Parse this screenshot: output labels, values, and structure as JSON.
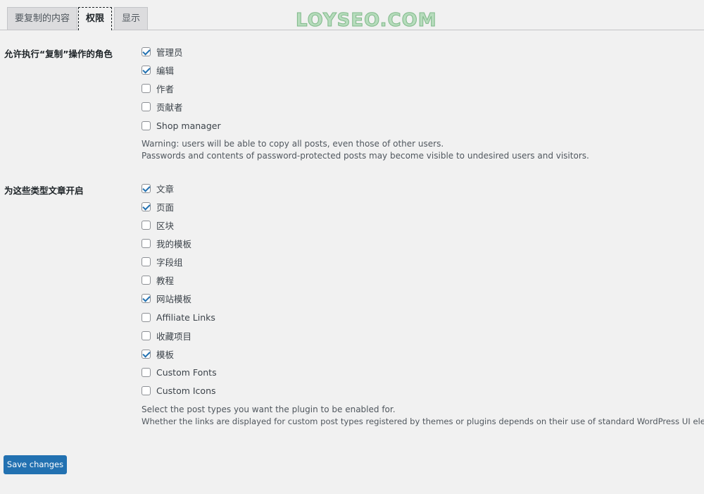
{
  "tabs": [
    {
      "label": "要复制的内容",
      "active": false
    },
    {
      "label": "权限",
      "active": true
    },
    {
      "label": "显示",
      "active": false
    }
  ],
  "watermark": "LOYSEO.COM",
  "roles": {
    "label": "允许执行“复制”操作的角色",
    "options": [
      {
        "label": "管理员",
        "checked": true
      },
      {
        "label": "编辑",
        "checked": true
      },
      {
        "label": "作者",
        "checked": false
      },
      {
        "label": "贡献者",
        "checked": false
      },
      {
        "label": "Shop manager",
        "checked": false
      }
    ],
    "desc_line1": "Warning: users will be able to copy all posts, even those of other users.",
    "desc_line2": "Passwords and contents of password-protected posts may become visible to undesired users and visitors."
  },
  "post_types": {
    "label": "为这些类型文章开启",
    "options": [
      {
        "label": "文章",
        "checked": true
      },
      {
        "label": "页面",
        "checked": true
      },
      {
        "label": "区块",
        "checked": false
      },
      {
        "label": "我的模板",
        "checked": false
      },
      {
        "label": "字段组",
        "checked": false
      },
      {
        "label": "教程",
        "checked": false
      },
      {
        "label": "网站模板",
        "checked": true
      },
      {
        "label": "Affiliate Links",
        "checked": false
      },
      {
        "label": "收藏项目",
        "checked": false
      },
      {
        "label": "模板",
        "checked": true
      },
      {
        "label": "Custom Fonts",
        "checked": false
      },
      {
        "label": "Custom Icons",
        "checked": false
      }
    ],
    "desc_line1": "Select the post types you want the plugin to be enabled for.",
    "desc_line2": "Whether the links are displayed for custom post types registered by themes or plugins depends on their use of standard WordPress UI elements."
  },
  "save_label": "Save changes",
  "colors": {
    "accent": "#2271b1",
    "background": "#f1f1f1"
  }
}
